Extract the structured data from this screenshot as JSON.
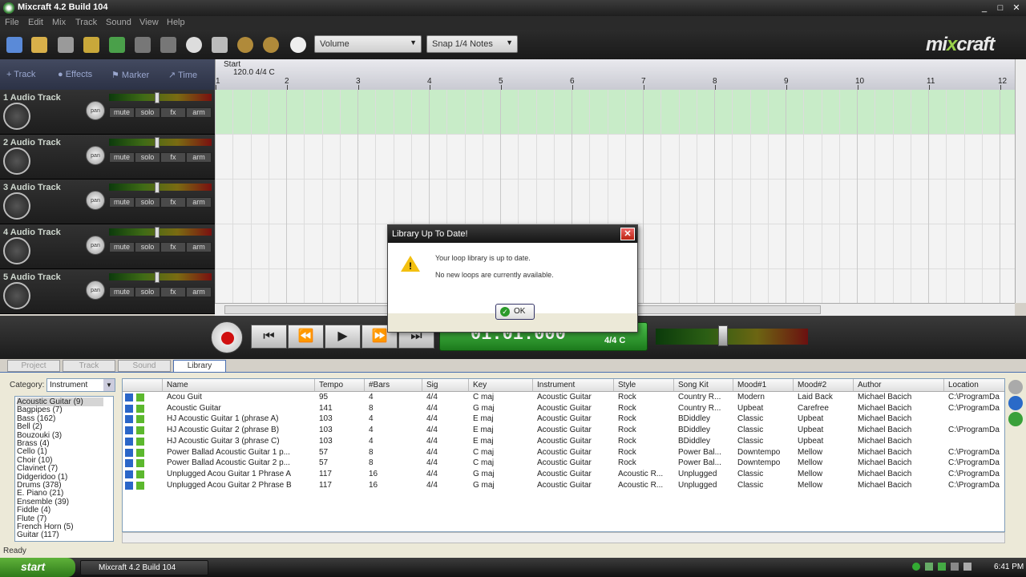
{
  "window": {
    "title": "Mixcraft 4.2 Build 104",
    "min": "_",
    "max": "□",
    "close": "✕"
  },
  "menu": [
    "File",
    "Edit",
    "Mix",
    "Track",
    "Sound",
    "View",
    "Help"
  ],
  "toolbar": {
    "volume_select": "Volume",
    "snap_select": "Snap 1/4 Notes",
    "logo_a": "mi",
    "logo_x": "x",
    "logo_b": "craft"
  },
  "track_header": {
    "track": "Track",
    "effects": "Effects",
    "marker": "Marker",
    "time": "Time"
  },
  "ruler": {
    "start_label": "Start",
    "tempo_label": "120.0 4/4 C",
    "bars": [
      "1",
      "2",
      "3",
      "4",
      "5",
      "6",
      "7",
      "8",
      "9",
      "10",
      "11",
      "12"
    ]
  },
  "tracks": [
    {
      "name": "1  Audio Track"
    },
    {
      "name": "2  Audio Track"
    },
    {
      "name": "3  Audio Track"
    },
    {
      "name": "4  Audio Track"
    },
    {
      "name": "5  Audio Track"
    }
  ],
  "track_buttons": {
    "pan": "pan",
    "mute": "mute",
    "solo": "solo",
    "fx": "fx",
    "arm": "arm"
  },
  "transport": {
    "time": "01:01.000",
    "signature": "4/4  C",
    "rewind_start": "⏮",
    "rewind": "⏪",
    "play": "▶",
    "forward": "⏩",
    "end": "⏭"
  },
  "lib_tabs": [
    "Project",
    "Track",
    "Sound",
    "Library"
  ],
  "category": {
    "label": "Category:",
    "value": "Instrument"
  },
  "categories": [
    "Acoustic Guitar  (9)",
    "Bagpipes  (7)",
    "Bass  (162)",
    "Bell  (2)",
    "Bouzouki  (3)",
    "Brass  (4)",
    "Cello  (1)",
    "Choir  (10)",
    "Clavinet  (7)",
    "Didgeridoo  (1)",
    "Drums  (378)",
    "E. Piano  (21)",
    "Ensemble  (39)",
    "Fiddle  (4)",
    "Flute  (7)",
    "French Horn  (5)",
    "Guitar  (117)"
  ],
  "columns": [
    "Name",
    "Tempo",
    "#Bars",
    "Sig",
    "Key",
    "Instrument",
    "Style",
    "Song Kit",
    "Mood#1",
    "Mood#2",
    "Author",
    "Location"
  ],
  "rows": [
    [
      "Acou Guit",
      "95",
      "4",
      "4/4",
      "C maj",
      "Acoustic Guitar",
      "Rock",
      "Country R...",
      "Modern",
      "Laid Back",
      "Michael Bacich",
      "C:\\ProgramDa"
    ],
    [
      "Acoustic Guitar",
      "141",
      "8",
      "4/4",
      "G maj",
      "Acoustic Guitar",
      "Rock",
      "Country R...",
      "Upbeat",
      "Carefree",
      "Michael Bacich",
      "C:\\ProgramDa"
    ],
    [
      "HJ Acoustic Guitar 1 (phrase A)",
      "103",
      "4",
      "4/4",
      "E maj",
      "Acoustic Guitar",
      "Rock",
      "BDiddley",
      "Classic",
      "Upbeat",
      "Michael Bacich",
      ""
    ],
    [
      "HJ Acoustic Guitar 2 (phrase B)",
      "103",
      "4",
      "4/4",
      "E maj",
      "Acoustic Guitar",
      "Rock",
      "BDiddley",
      "Classic",
      "Upbeat",
      "Michael Bacich",
      "C:\\ProgramDa"
    ],
    [
      "HJ Acoustic Guitar 3 (phrase C)",
      "103",
      "4",
      "4/4",
      "E maj",
      "Acoustic Guitar",
      "Rock",
      "BDiddley",
      "Classic",
      "Upbeat",
      "Michael Bacich",
      ""
    ],
    [
      "Power Ballad Acoustic Guitar 1 p...",
      "57",
      "8",
      "4/4",
      "C maj",
      "Acoustic Guitar",
      "Rock",
      "Power Bal...",
      "Downtempo",
      "Mellow",
      "Michael Bacich",
      "C:\\ProgramDa"
    ],
    [
      "Power Ballad Acoustic Guitar 2 p...",
      "57",
      "8",
      "4/4",
      "C maj",
      "Acoustic Guitar",
      "Rock",
      "Power Bal...",
      "Downtempo",
      "Mellow",
      "Michael Bacich",
      "C:\\ProgramDa"
    ],
    [
      "Unplugged Acou Guitar 1 Phrase A",
      "117",
      "16",
      "4/4",
      "G maj",
      "Acoustic Guitar",
      "Acoustic R...",
      "Unplugged",
      "Classic",
      "Mellow",
      "Michael Bacich",
      "C:\\ProgramDa"
    ],
    [
      "Unplugged Acou Guitar 2 Phrase B",
      "117",
      "16",
      "4/4",
      "G maj",
      "Acoustic Guitar",
      "Acoustic R...",
      "Unplugged",
      "Classic",
      "Mellow",
      "Michael Bacich",
      "C:\\ProgramDa"
    ]
  ],
  "status": "Ready",
  "taskbar": {
    "start": "start",
    "item": "Mixcraft 4.2 Build 104",
    "clock": "6:41 PM"
  },
  "dialog": {
    "title": "Library Up To Date!",
    "line1": "Your loop library is up to date.",
    "line2": "No new loops are currently available.",
    "ok": "OK",
    "close": "✕"
  }
}
